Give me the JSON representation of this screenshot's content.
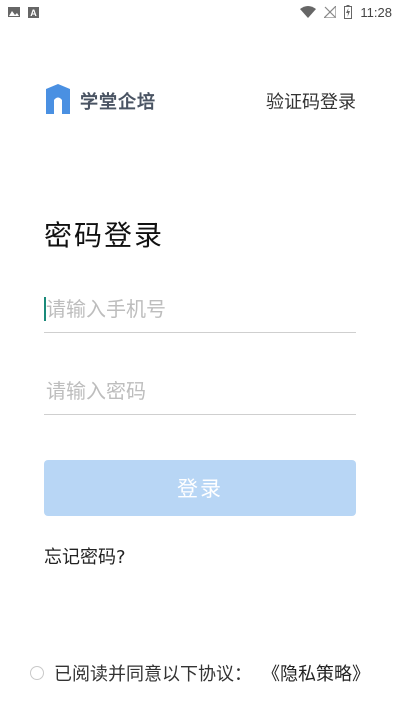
{
  "status_bar": {
    "time": "11:28",
    "left_icons": [
      "image-icon",
      "text-a-icon"
    ],
    "right_icons": [
      "wifi-icon",
      "no-signal-icon",
      "battery-charging-icon"
    ]
  },
  "header": {
    "brand_name": "学堂企培",
    "code_login_label": "验证码登录"
  },
  "page_title": "密码登录",
  "phone_input": {
    "placeholder": "请输入手机号",
    "value": ""
  },
  "password_input": {
    "placeholder": "请输入密码",
    "value": ""
  },
  "login_button": {
    "label": "登录"
  },
  "forgot_password": "忘记密码?",
  "agreement": {
    "text": "已阅读并同意以下协议：",
    "link": "《隐私策略》",
    "checked": false
  },
  "colors": {
    "brand": "#4a90e2",
    "button_disabled": "#b8d6f5",
    "caret": "#1a8a7a"
  }
}
